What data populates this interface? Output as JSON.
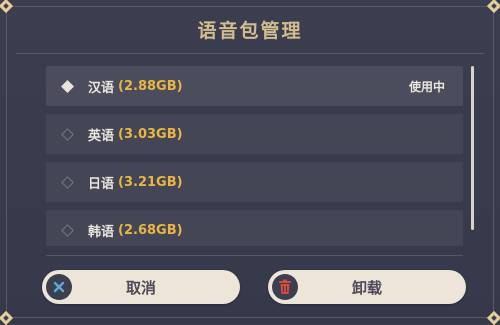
{
  "dialog": {
    "title": "语音包管理"
  },
  "languages": [
    {
      "name": "汉语",
      "size": "(2.88GB)",
      "status": "使用中",
      "selected": true
    },
    {
      "name": "英语",
      "size": "(3.03GB)",
      "status": "",
      "selected": false
    },
    {
      "name": "日语",
      "size": "(3.21GB)",
      "status": "",
      "selected": false
    },
    {
      "name": "韩语",
      "size": "(2.68GB)",
      "status": "",
      "selected": false
    }
  ],
  "buttons": {
    "cancel": "取消",
    "uninstall": "卸载"
  },
  "icons": {
    "cancel": "close-icon",
    "uninstall": "trash-icon"
  },
  "colors": {
    "title": "#d3bc8e",
    "size_highlight": "#e8b742",
    "button_bg": "#ece5d8",
    "panel_bg": "#3b3e4f",
    "cancel_icon_accent": "#5ea9d8",
    "uninstall_icon_accent": "#d44b3c"
  }
}
